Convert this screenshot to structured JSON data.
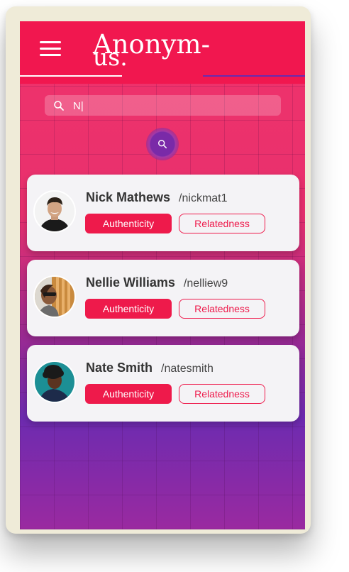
{
  "app": {
    "logo_line1": "Anonym-",
    "logo_line2": "us."
  },
  "search": {
    "value": "N|",
    "placeholder": ""
  },
  "colors": {
    "accent": "#ee1a4b",
    "header": "#f1174f",
    "button_purple": "#7a2aa8"
  },
  "icons": {
    "menu": "hamburger-menu-icon",
    "search": "search-icon"
  },
  "results": [
    {
      "name": "Nick Mathews",
      "handle": "/nickmat1",
      "tag1": "Authenticity",
      "tag2": "Relatedness"
    },
    {
      "name": "Nellie Williams",
      "handle": "/nelliew9",
      "tag1": "Authenticity",
      "tag2": "Relatedness"
    },
    {
      "name": "Nate Smith",
      "handle": "/natesmith",
      "tag1": "Authenticity",
      "tag2": "Relatedness"
    }
  ]
}
